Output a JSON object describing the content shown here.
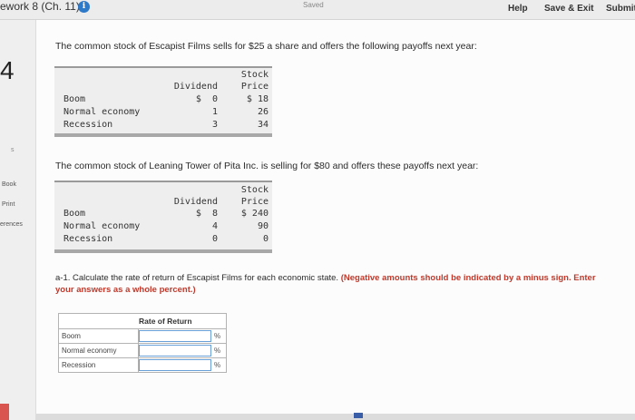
{
  "header": {
    "assignment_title": "ework 8 (Ch. 11)",
    "info_glyph": "i",
    "saved_label": "Saved",
    "help_label": "Help",
    "save_exit_label": "Save & Exit",
    "submit_label": "Submit"
  },
  "sidebar": {
    "question_number": "4",
    "points_fragment": "s",
    "book_label": "Book",
    "print_label": "Print",
    "references_label": "erences"
  },
  "question": {
    "intro1": "The common stock of Escapist Films sells for $25 a share and offers the following payoffs next year:",
    "table1": {
      "header_dividend": "Dividend",
      "header_price_line1": "Stock",
      "header_price_line2": "Price",
      "rows": [
        {
          "state": "Boom",
          "dividend": "$  0",
          "price": "$ 18"
        },
        {
          "state": "Normal economy",
          "dividend": "1",
          "price": "26"
        },
        {
          "state": "Recession",
          "dividend": "3",
          "price": "34"
        }
      ]
    },
    "intro2": "The common stock of Leaning Tower of Pita Inc. is selling for $80 and offers these payoffs next year:",
    "table2": {
      "header_dividend": "Dividend",
      "header_price_line1": "Stock",
      "header_price_line2": "Price",
      "rows": [
        {
          "state": "Boom",
          "dividend": "$  8",
          "price": "$ 240"
        },
        {
          "state": "Normal economy",
          "dividend": "4",
          "price": "90"
        },
        {
          "state": "Recession",
          "dividend": "0",
          "price": "0"
        }
      ]
    },
    "instruction_plain": "a-1. Calculate the rate of return of Escapist Films for each economic state. ",
    "instruction_bold": "(Negative amounts should be indicated by a minus sign. Enter your answers as a whole percent.)"
  },
  "answer_table": {
    "header": "Rate of Return",
    "rows": [
      {
        "label": "Boom",
        "value": "",
        "unit": "%"
      },
      {
        "label": "Normal economy",
        "value": "",
        "unit": "%"
      },
      {
        "label": "Recession",
        "value": "",
        "unit": "%"
      }
    ]
  }
}
